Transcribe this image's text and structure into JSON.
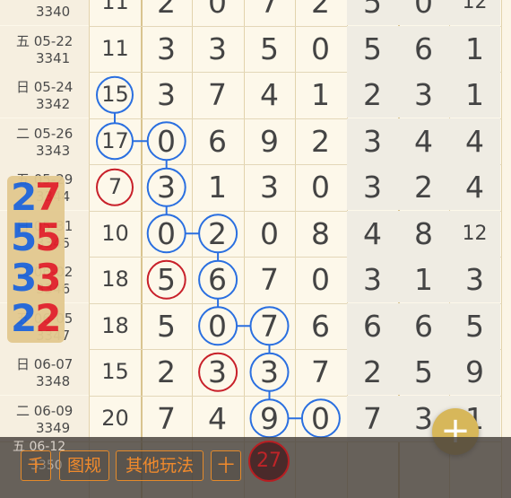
{
  "rows": [
    {
      "date": "",
      "num": "3340",
      "sum": "11",
      "digits": [
        "2",
        "0",
        "7",
        "2",
        "5",
        "0",
        "12"
      ]
    },
    {
      "date": "五 05-22",
      "num": "3341",
      "sum": "11",
      "digits": [
        "3",
        "3",
        "5",
        "0",
        "5",
        "6",
        "1"
      ]
    },
    {
      "date": "日 05-24",
      "num": "3342",
      "sum": "15",
      "digits": [
        "3",
        "7",
        "4",
        "1",
        "2",
        "3",
        "1"
      ]
    },
    {
      "date": "二 05-26",
      "num": "3343",
      "sum": "17",
      "digits": [
        "0",
        "6",
        "9",
        "2",
        "3",
        "4",
        "4"
      ]
    },
    {
      "date": "五 05-29",
      "num": "3344",
      "sum": "7",
      "digits": [
        "3",
        "1",
        "3",
        "0",
        "3",
        "2",
        "4"
      ]
    },
    {
      "date": "日 05-31",
      "num": "3345",
      "sum": "10",
      "digits": [
        "0",
        "2",
        "0",
        "8",
        "4",
        "8",
        "12"
      ]
    },
    {
      "date": "二 06-02",
      "num": "3346",
      "sum": "18",
      "digits": [
        "5",
        "6",
        "7",
        "0",
        "3",
        "1",
        "3"
      ]
    },
    {
      "date": "五 06-05",
      "num": "3347",
      "sum": "18",
      "digits": [
        "5",
        "0",
        "7",
        "6",
        "6",
        "6",
        "5"
      ]
    },
    {
      "date": "日 06-07",
      "num": "3348",
      "sum": "15",
      "digits": [
        "2",
        "3",
        "3",
        "7",
        "2",
        "5",
        "9"
      ]
    },
    {
      "date": "二 06-09",
      "num": "3349",
      "sum": "20",
      "digits": [
        "7",
        "4",
        "9",
        "0",
        "7",
        "3",
        "1"
      ]
    }
  ],
  "next_row": {
    "date": "五 06-12",
    "num": "3350"
  },
  "badge": [
    [
      "2",
      "7"
    ],
    [
      "5",
      "5"
    ],
    [
      "3",
      "3"
    ],
    [
      "2",
      "2"
    ]
  ],
  "toolbar": {
    "btn1": "千",
    "btn2": "图规",
    "btn3": "其他玩法",
    "btn4": "十",
    "result": "27"
  },
  "fab_label": "+",
  "colors": {
    "blue": "#2a6fe0",
    "red": "#c8202a",
    "orange": "#f08a2c",
    "gold": "#d7b75a"
  }
}
